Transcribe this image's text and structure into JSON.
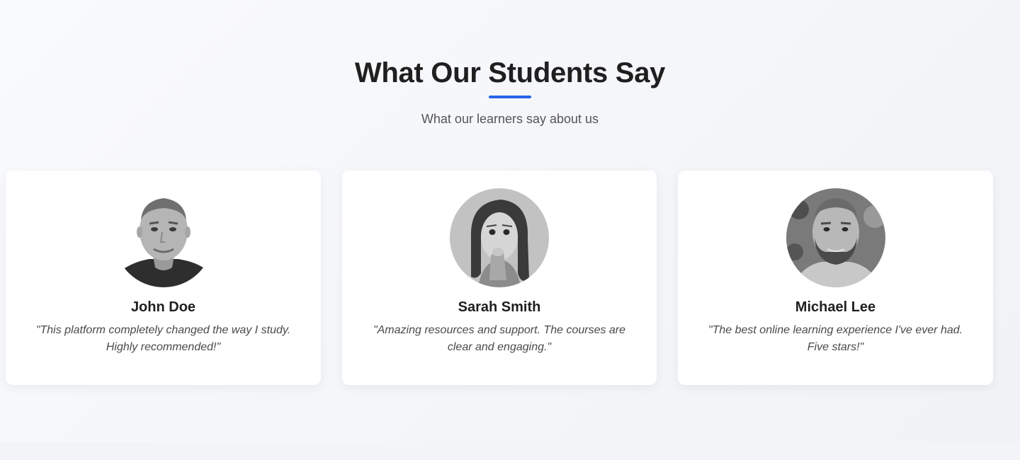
{
  "section": {
    "title": "What Our Students Say",
    "subtitle": "What our learners say about us",
    "accent_color": "#2563eb"
  },
  "testimonials": [
    {
      "name": "John Doe",
      "quote": "\"This platform completely changed the way I study. Highly recommended!\"",
      "avatar_icon": "john-doe-avatar"
    },
    {
      "name": "Sarah Smith",
      "quote": "\"Amazing resources and support. The courses are clear and engaging.\"",
      "avatar_icon": "sarah-smith-avatar"
    },
    {
      "name": "Michael Lee",
      "quote": "\"The best online learning experience I've ever had. Five stars!\"",
      "avatar_icon": "michael-lee-avatar"
    }
  ]
}
